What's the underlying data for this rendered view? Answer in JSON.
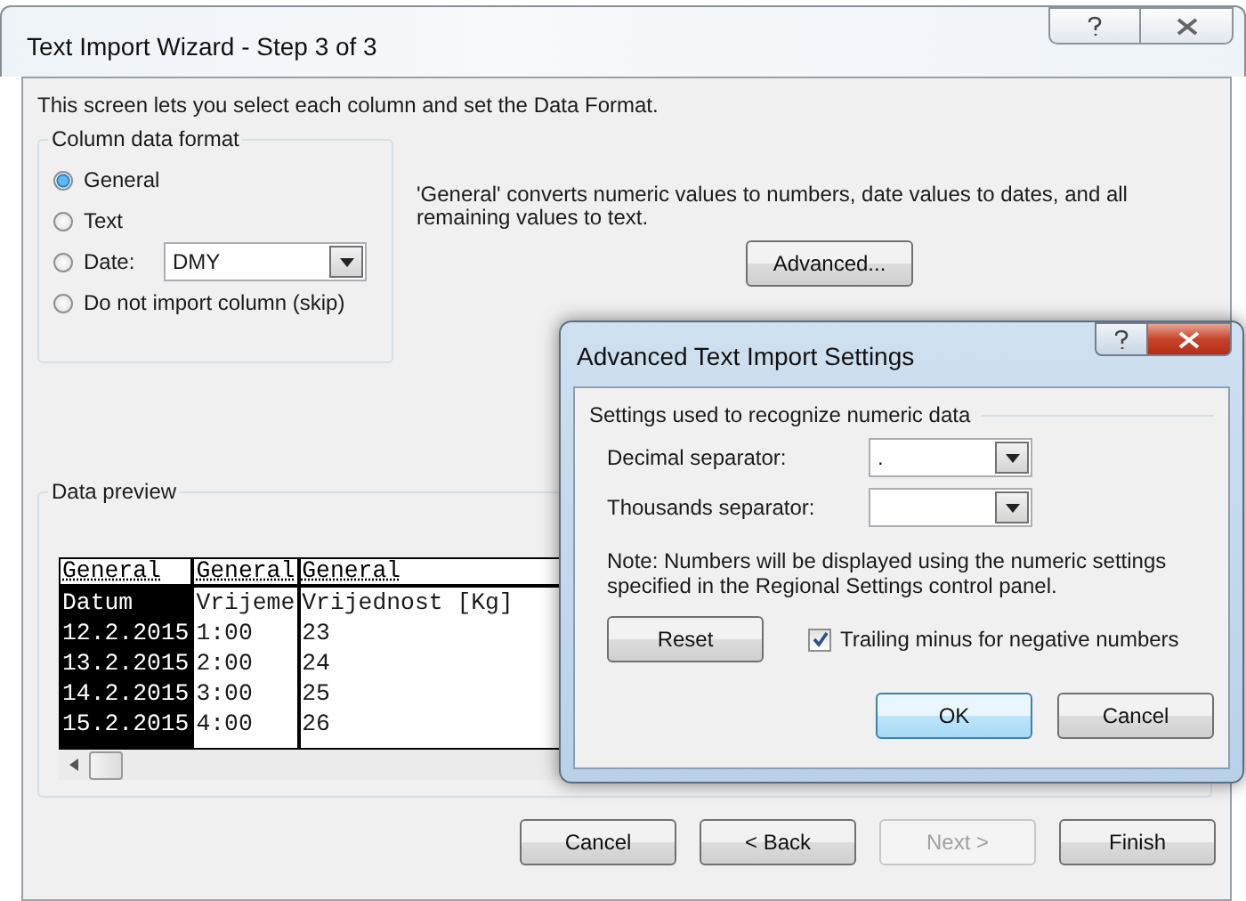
{
  "window": {
    "title": "Text Import Wizard - Step 3 of 3"
  },
  "intro": "This screen lets you select each column and set the Data Format.",
  "column_data_format": {
    "legend": "Column data format",
    "options": [
      {
        "kind": "radio",
        "label": "General",
        "selected": true
      },
      {
        "kind": "radio",
        "label": "Text",
        "selected": false
      },
      {
        "kind": "date",
        "label": "Date:",
        "selected": false,
        "value": "DMY"
      },
      {
        "kind": "radio",
        "label": "Do not import column (skip)",
        "selected": false
      }
    ]
  },
  "description": "'General' converts numeric values to numbers, date values to dates, and all remaining values to text.",
  "advanced_button": {
    "label": "Advanced..."
  },
  "data_preview": {
    "legend": "Data preview",
    "columns": [
      {
        "format": "General",
        "selected": true,
        "cells": [
          "Datum",
          "12.2.2015",
          "13.2.2015",
          "14.2.2015",
          "15.2.2015"
        ]
      },
      {
        "format": "General",
        "selected": false,
        "cells": [
          "Vrijeme",
          "1:00",
          "2:00",
          "3:00",
          "4:00"
        ]
      },
      {
        "format": "General",
        "selected": false,
        "cells": [
          "Vrijednost [Kg]",
          "23",
          "24",
          "25",
          "26"
        ]
      }
    ]
  },
  "buttons": [
    {
      "label": "Cancel",
      "disabled": false
    },
    {
      "label": "< Back",
      "disabled": false
    },
    {
      "label": "Next >",
      "disabled": true
    },
    {
      "label": "Finish",
      "disabled": false
    }
  ],
  "advanced_dialog": {
    "title": "Advanced Text Import Settings",
    "legend": "Settings used to recognize numeric data",
    "fields": [
      {
        "label": "Decimal separator:",
        "value": "."
      },
      {
        "label": "Thousands separator:"
      }
    ],
    "note": "Note: Numbers will be displayed using the numeric settings specified in the Regional Settings control panel.",
    "reset_button": {
      "label": "Reset"
    },
    "checkbox": {
      "label": "Trailing minus for negative numbers",
      "checked": true
    },
    "buttons": [
      {
        "label": "OK",
        "default": true
      },
      {
        "label": "Cancel",
        "default": false
      }
    ]
  }
}
